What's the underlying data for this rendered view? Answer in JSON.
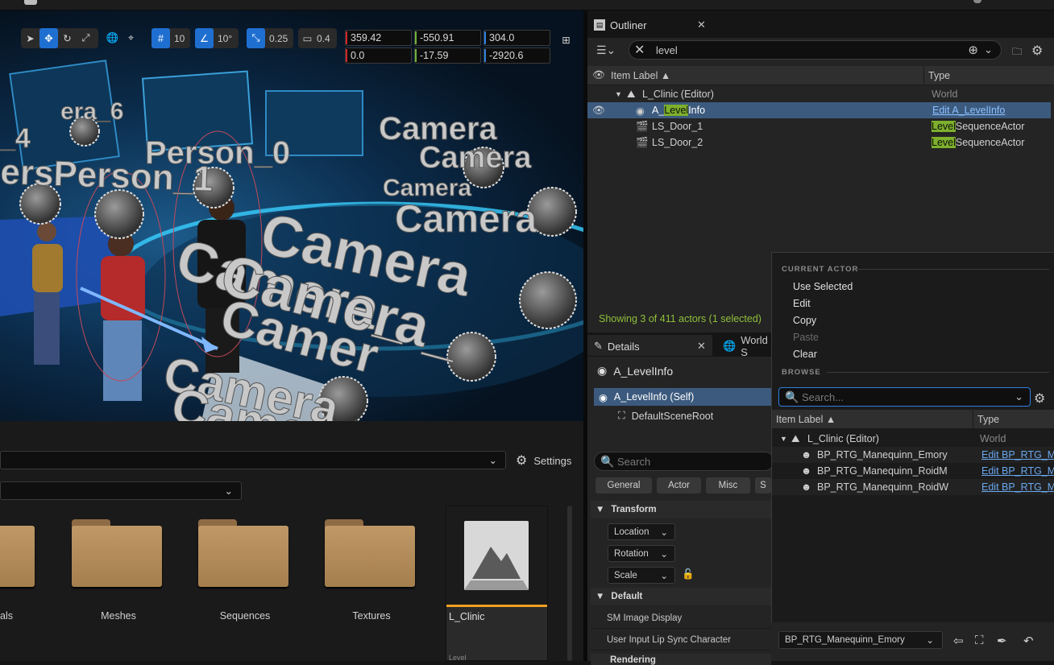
{
  "viewport": {
    "toolbar": {
      "grid_snap": "10",
      "rotation_snap": "10°",
      "scale_snap": "0.25",
      "camera_speed": "0.4"
    },
    "coords": {
      "loc_x": "359.42",
      "loc_y": "-550.91",
      "loc_z": "304.0",
      "rot_x": "0.0",
      "rot_y": "-17.59",
      "rot_z": "-2920.6"
    },
    "scene_labels": [
      "era_6",
      "_4",
      "Person_0",
      "ersPerson_1",
      "Camera",
      "Camera",
      "Camera",
      "Camera",
      "Camera",
      "Camera_",
      "Camer",
      "Camera_",
      "Camera",
      "Camera_"
    ]
  },
  "outliner": {
    "tab_title": "Outliner",
    "search_value": "level",
    "col_label": "Item Label",
    "col_type": "Type",
    "rows": [
      {
        "label": "L_Clinic (Editor)",
        "type": "World"
      },
      {
        "label_pre": "A_",
        "label_hl": "Level",
        "label_post": "Info",
        "type": "Edit A_LevelInfo"
      },
      {
        "label": "LS_Door_1",
        "type_hl": "Level",
        "type_post": "SequenceActor"
      },
      {
        "label": "LS_Door_2",
        "type_hl": "Level",
        "type_post": "SequenceActor"
      }
    ],
    "status": "Showing 3 of 411 actors (1 selected)"
  },
  "details": {
    "tab_title": "Details",
    "tab2_title": "World S",
    "actor_name": "A_LevelInfo",
    "component_self": "A_LevelInfo (Self)",
    "component_root": "DefaultSceneRoot",
    "search_placeholder": "Search",
    "filters": [
      "General",
      "Actor",
      "Misc",
      "S"
    ],
    "transform_label": "Transform",
    "location_label": "Location",
    "rotation_label": "Rotation",
    "scale_label": "Scale",
    "default_label": "Default",
    "sm_image_display": "SM Image Display",
    "lip_sync_label": "User Input Lip Sync Character",
    "lip_sync_value": "BP_RTG_Manequinn_Emory",
    "rendering_label": "Rendering"
  },
  "popup": {
    "section_current": "CURRENT ACTOR",
    "use_selected": "Use Selected",
    "edit": "Edit",
    "copy": "Copy",
    "paste": "Paste",
    "clear": "Clear",
    "section_browse": "BROWSE",
    "search_placeholder": "Search...",
    "col_label": "Item Label",
    "col_type": "Type",
    "rows": [
      {
        "label": "L_Clinic (Editor)",
        "type": "World"
      },
      {
        "label": "BP_RTG_Manequinn_Emory",
        "type": "Edit BP_RTG_Ma"
      },
      {
        "label": "BP_RTG_Manequinn_RoidM",
        "type": "Edit BP_RTG_Ma"
      },
      {
        "label": "BP_RTG_Manequinn_RoidW",
        "type": "Edit BP_RTG_Ma"
      }
    ]
  },
  "content_browser": {
    "settings_label": "Settings",
    "folders": [
      "als",
      "Meshes",
      "Sequences",
      "Textures"
    ],
    "asset_name": "L_Clinic",
    "asset_type": "Level"
  },
  "colors": {
    "accent_blue": "#1f6fd1",
    "highlight_green": "#7db02c",
    "status_green": "#8fbf3a",
    "asset_orange": "#f0a020"
  }
}
